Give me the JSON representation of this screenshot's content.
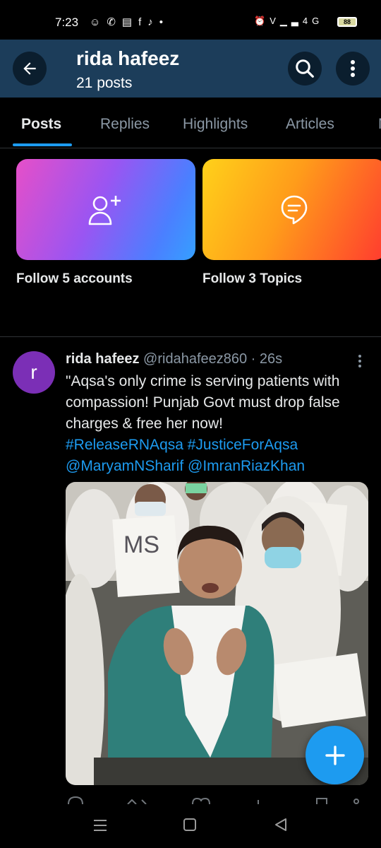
{
  "status_bar": {
    "time": "7:23",
    "left_icons": [
      "snapchat-icon",
      "whatsapp-icon",
      "sim-icon",
      "facebook-icon",
      "tiktok-icon",
      "dot-icon"
    ],
    "right_icons": [
      "alarm-icon",
      "volte-icon",
      "signal-icon",
      "signal-4g-icon"
    ],
    "battery": "88"
  },
  "header": {
    "name": "rida hafeez",
    "post_count": "21 posts",
    "background": "#1c3d5a"
  },
  "tabs": [
    {
      "label": "Posts",
      "active": true
    },
    {
      "label": "Replies",
      "active": false
    },
    {
      "label": "Highlights",
      "active": false
    },
    {
      "label": "Articles",
      "active": false
    },
    {
      "label": "M",
      "active": false
    }
  ],
  "cards": [
    {
      "label": "Follow 5 accounts",
      "icon": "add-user-icon"
    },
    {
      "label": "Follow 3 Topics",
      "icon": "topic-bubble-icon"
    }
  ],
  "tweet": {
    "avatar_letter": "r",
    "author": "rida hafeez",
    "handle": "@ridahafeez860",
    "time": " · 26s",
    "text": "\"Aqsa's only crime is serving patients with compassion! Punjab Govt must drop false charges & free her now!",
    "hashtags": "#ReleaseRNAqsa #JusticeForAqsa",
    "mentions": "@MaryamNSharif @ImranRiazKhan",
    "media_sign_text": "MS"
  },
  "colors": {
    "accent": "#1d9bf0",
    "avatar": "#7b2fb6"
  }
}
